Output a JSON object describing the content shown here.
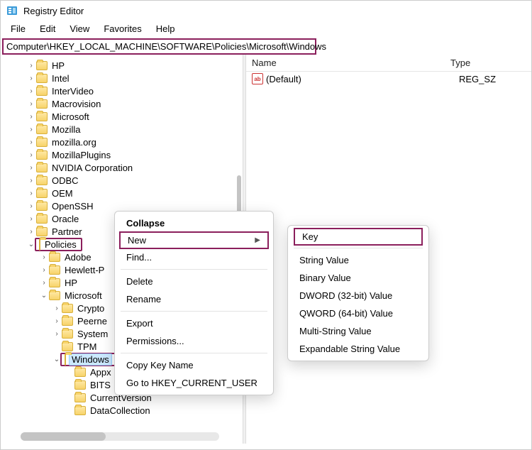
{
  "window": {
    "title": "Registry Editor"
  },
  "menu": {
    "file": "File",
    "edit": "Edit",
    "view": "View",
    "favorites": "Favorites",
    "help": "Help"
  },
  "address": "Computer\\HKEY_LOCAL_MACHINE\\SOFTWARE\\Policies\\Microsoft\\Windows",
  "tree": {
    "items": [
      {
        "indent": 36,
        "twisty": ">",
        "label": "HP"
      },
      {
        "indent": 36,
        "twisty": ">",
        "label": "Intel"
      },
      {
        "indent": 36,
        "twisty": ">",
        "label": "InterVideo"
      },
      {
        "indent": 36,
        "twisty": ">",
        "label": "Macrovision"
      },
      {
        "indent": 36,
        "twisty": ">",
        "label": "Microsoft"
      },
      {
        "indent": 36,
        "twisty": ">",
        "label": "Mozilla"
      },
      {
        "indent": 36,
        "twisty": ">",
        "label": "mozilla.org"
      },
      {
        "indent": 36,
        "twisty": ">",
        "label": "MozillaPlugins"
      },
      {
        "indent": 36,
        "twisty": ">",
        "label": "NVIDIA Corporation"
      },
      {
        "indent": 36,
        "twisty": ">",
        "label": "ODBC"
      },
      {
        "indent": 36,
        "twisty": ">",
        "label": "OEM"
      },
      {
        "indent": 36,
        "twisty": ">",
        "label": "OpenSSH"
      },
      {
        "indent": 36,
        "twisty": ">",
        "label": "Oracle"
      },
      {
        "indent": 36,
        "twisty": ">",
        "label": "Partner"
      },
      {
        "indent": 36,
        "twisty": "v",
        "label": "Policies",
        "highlight": true
      },
      {
        "indent": 54,
        "twisty": ">",
        "label": "Adobe"
      },
      {
        "indent": 54,
        "twisty": ">",
        "label": "Hewlett-P"
      },
      {
        "indent": 54,
        "twisty": ">",
        "label": "HP"
      },
      {
        "indent": 54,
        "twisty": "v",
        "label": "Microsoft"
      },
      {
        "indent": 72,
        "twisty": ">",
        "label": "Crypto"
      },
      {
        "indent": 72,
        "twisty": ">",
        "label": "Peerne"
      },
      {
        "indent": 72,
        "twisty": ">",
        "label": "System"
      },
      {
        "indent": 72,
        "twisty": "",
        "label": "TPM"
      },
      {
        "indent": 72,
        "twisty": "v",
        "label": "Windows",
        "selected": true,
        "highlight": true
      },
      {
        "indent": 90,
        "twisty": "",
        "label": "Appx"
      },
      {
        "indent": 90,
        "twisty": "",
        "label": "BITS"
      },
      {
        "indent": 90,
        "twisty": "",
        "label": "CurrentVersion"
      },
      {
        "indent": 90,
        "twisty": "",
        "label": "DataCollection"
      }
    ]
  },
  "list": {
    "headers": {
      "name": "Name",
      "type": "Type"
    },
    "rows": [
      {
        "name": "(Default)",
        "type": "REG_SZ"
      }
    ]
  },
  "context1": {
    "collapse": "Collapse",
    "new": "New",
    "find": "Find...",
    "delete": "Delete",
    "rename": "Rename",
    "export": "Export",
    "permissions": "Permissions...",
    "copykey": "Copy Key Name",
    "gotohkcu": "Go to HKEY_CURRENT_USER"
  },
  "context2": {
    "key": "Key",
    "string": "String Value",
    "binary": "Binary Value",
    "dword": "DWORD (32-bit) Value",
    "qword": "QWORD (64-bit) Value",
    "multi": "Multi-String Value",
    "expand": "Expandable String Value"
  }
}
